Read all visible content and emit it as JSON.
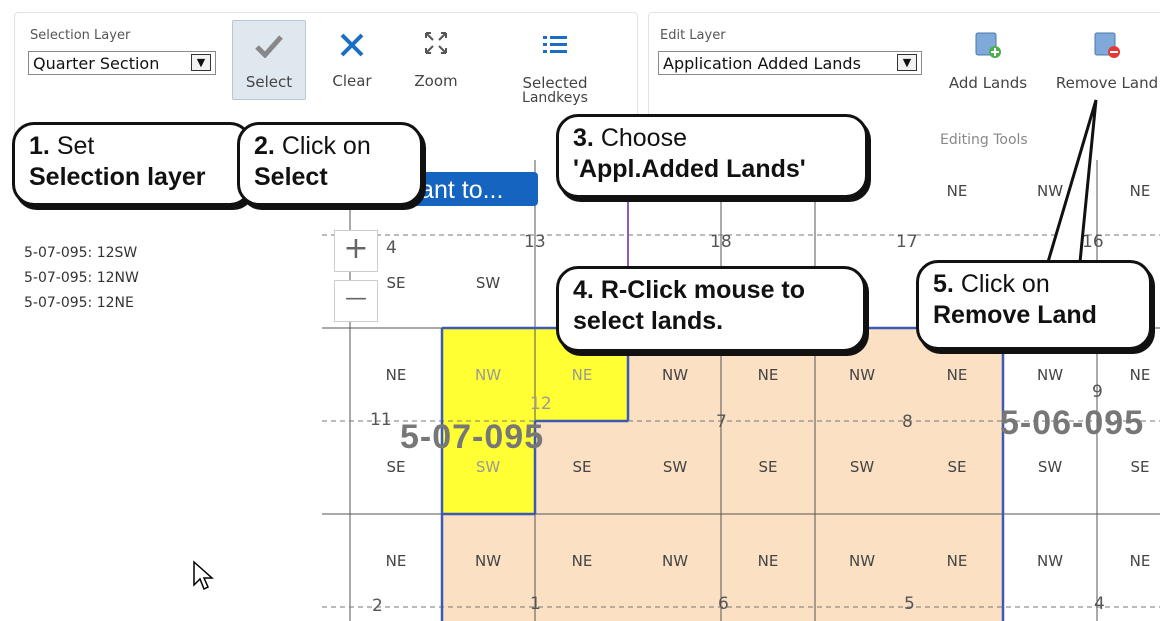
{
  "selection": {
    "layer_label": "Selection Layer",
    "layer_value": "Quarter Section",
    "buttons": {
      "select": "Select",
      "clear": "Clear",
      "zoom": "Zoom",
      "selected_1": "Selected",
      "selected_2": "Landkeys"
    }
  },
  "edit": {
    "layer_label": "Edit Layer",
    "layer_value": "Application Added Lands",
    "buttons": {
      "add": "Add Lands",
      "remove": "Remove Land"
    },
    "group_label": "Editing Tools"
  },
  "callouts": {
    "c1": {
      "num": "1.",
      "line1": "Set",
      "line2": "Selection layer"
    },
    "c2": {
      "num": "2.",
      "line1": "Click on",
      "line2": "Select"
    },
    "c3": {
      "num": "3.",
      "line1": "Choose",
      "line2": "'Appl.Added Lands'"
    },
    "c4": {
      "num": "4.",
      "line1": "R-Click mouse to",
      "line2": "select lands."
    },
    "c5": {
      "num": "5.",
      "line1": "Click on",
      "line2": "Remove Land"
    }
  },
  "i_want_to": "want to...",
  "selected_list": [
    "5-07-095: 12SW",
    "5-07-095: 12NW",
    "5-07-095: 12NE"
  ],
  "map": {
    "zoom_in": "+",
    "zoom_out": "—",
    "townships": {
      "west": "5-07-095",
      "east": "5-06-095"
    },
    "sections": {
      "s4": "4",
      "s13": "13",
      "s18": "18",
      "s17": "17",
      "s16": "16",
      "s11": "11",
      "s12": "12",
      "s7": "7",
      "s8": "8",
      "s9": "9",
      "s2": "2",
      "s1": "1",
      "s6": "6",
      "s5": "5",
      "s4b": "4"
    },
    "quarters": {
      "ne": "NE",
      "nw": "NW",
      "se": "SE",
      "sw": "SW"
    },
    "colors": {
      "selected": "#ffff33",
      "added": "#fbe0c4",
      "boundary": "#3c5ab4"
    }
  }
}
